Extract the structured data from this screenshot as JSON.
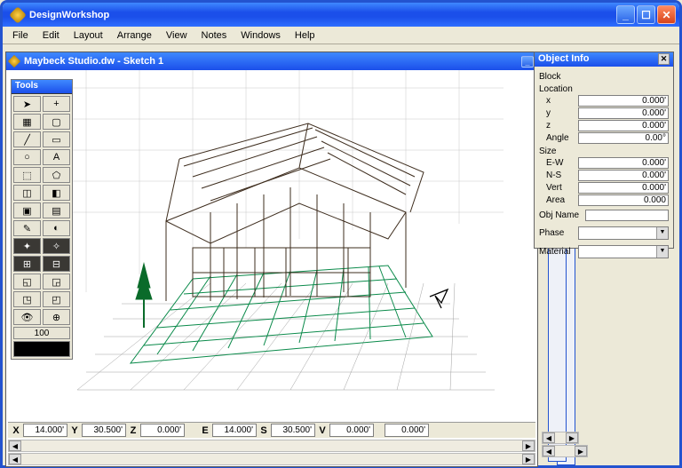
{
  "app": {
    "title": "DesignWorkshop"
  },
  "menu": [
    "File",
    "Edit",
    "Layout",
    "Arrange",
    "View",
    "Notes",
    "Windows",
    "Help"
  ],
  "document": {
    "title": "Maybeck Studio.dw - Sketch 1"
  },
  "tools": {
    "title": "Tools",
    "zoom": "100"
  },
  "status": {
    "x_label": "X",
    "x": "14.000'",
    "y_label": "Y",
    "y": "30.500'",
    "z_label": "Z",
    "z": "0.000'",
    "e_label": "E",
    "e": "14.000'",
    "s_label": "S",
    "s": "30.500'",
    "v_label": "V",
    "v": "0.000'",
    "extra": "0.000'"
  },
  "object_info": {
    "title": "Object Info",
    "block_heading": "Block",
    "location_heading": "Location",
    "x_label": "x",
    "x_value": "0.000'",
    "y_label": "y",
    "y_value": "0.000'",
    "z_label": "z",
    "z_value": "0.000'",
    "angle_label": "Angle",
    "angle_value": "0.00°",
    "size_heading": "Size",
    "ew_label": "E-W",
    "ew_value": "0.000'",
    "ns_label": "N-S",
    "ns_value": "0.000'",
    "vert_label": "Vert",
    "vert_value": "0.000'",
    "area_label": "Area",
    "area_value": "0.000",
    "objname_label": "Obj Name",
    "objname_value": "",
    "phase_label": "Phase",
    "phase_value": "",
    "material_label": "Material",
    "material_value": ""
  }
}
